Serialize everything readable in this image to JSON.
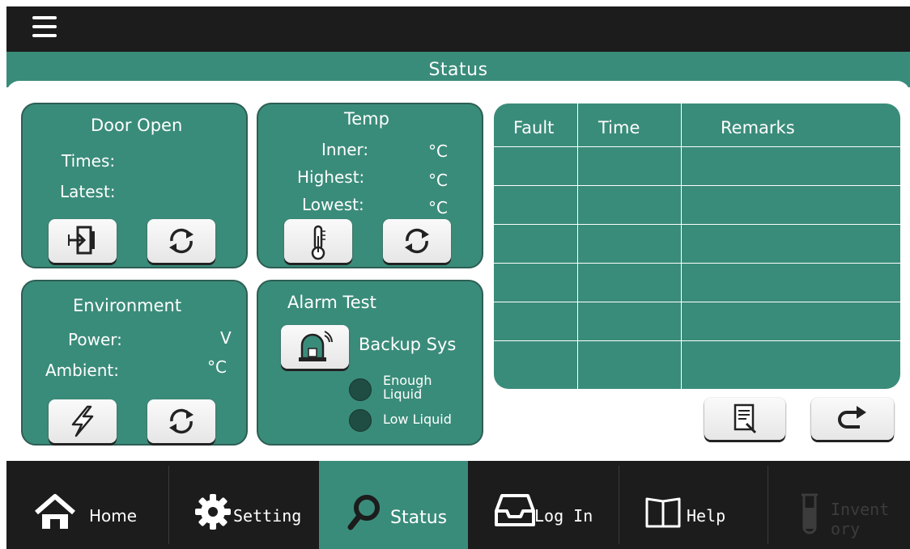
{
  "header": {
    "menu_icon": "hamburger-menu-icon",
    "title": "Status"
  },
  "door_panel": {
    "title": "Door Open",
    "times_label": "Times:",
    "latest_label": "Latest:",
    "buttons": [
      "door-exit-icon",
      "refresh-icon"
    ]
  },
  "temp_panel": {
    "title": "Temp",
    "inner_label": "Inner:",
    "highest_label": "Highest:",
    "lowest_label": "Lowest:",
    "unit": "°C",
    "buttons": [
      "thermometer-icon",
      "refresh-icon"
    ]
  },
  "env_panel": {
    "title": "Environment",
    "power_label": "Power:",
    "power_unit": "V",
    "ambient_label": "Ambient:",
    "ambient_unit": "°C",
    "buttons": [
      "lightning-icon",
      "refresh-icon"
    ]
  },
  "alarm_panel": {
    "title": "Alarm Test",
    "backup_label": "Backup Sys",
    "enough_liquid_label": "Enough\nLiquid",
    "low_liquid_label": "Low Liquid",
    "alarm_icon": "alarm-siren-icon"
  },
  "fault_table": {
    "columns": [
      "Fault",
      "Time",
      "Remarks"
    ],
    "rows": [
      [
        "",
        "",
        ""
      ],
      [
        "",
        "",
        ""
      ],
      [
        "",
        "",
        ""
      ],
      [
        "",
        "",
        ""
      ],
      [
        "",
        "",
        ""
      ],
      [
        "",
        "",
        ""
      ]
    ]
  },
  "table_actions": [
    "report-icon",
    "redo-arrow-icon"
  ],
  "nav": {
    "items": [
      {
        "label": "Home",
        "icon": "home-icon"
      },
      {
        "label": "Setting",
        "icon": "gear-icon"
      },
      {
        "label": "Status",
        "icon": "search-icon",
        "active": true
      },
      {
        "label": "Log In",
        "icon": "inbox-tray-icon"
      },
      {
        "label": "Help",
        "icon": "book-icon"
      },
      {
        "label": "Invent\nory",
        "icon": "test-tube-icon",
        "disabled": true
      }
    ]
  },
  "colors": {
    "accent": "#3a8c7a",
    "dark": "#1c1c1c",
    "led": "#1f4d43"
  }
}
